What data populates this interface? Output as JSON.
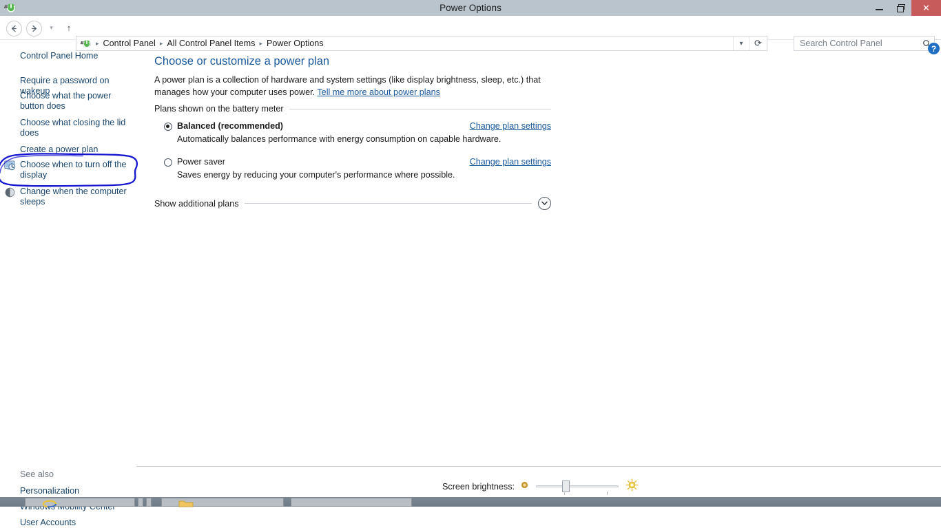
{
  "window": {
    "title": "Power Options",
    "icon": "power-options-icon",
    "controls": {
      "minimize": "–",
      "restore": "restore",
      "close": "✕"
    }
  },
  "navbar": {
    "back_icon": "←",
    "forward_icon": "→",
    "history_icon": "▾",
    "up_icon": "↑",
    "breadcrumbs": [
      "Control Panel",
      "All Control Panel Items",
      "Power Options"
    ],
    "separator": "▸",
    "dropdown_icon": "▾",
    "refresh_icon": "⟳"
  },
  "search": {
    "placeholder": "Search Control Panel",
    "value": "",
    "icon": "search-icon"
  },
  "help": {
    "label": "?"
  },
  "sidebar": {
    "home_label": "Control Panel Home",
    "items": [
      {
        "label": "Require a password on wakeup",
        "icon": null
      },
      {
        "label": "Choose what the power button does",
        "icon": null
      },
      {
        "label": "Choose what closing the lid does",
        "icon": null
      },
      {
        "label": "Create a power plan",
        "icon": null
      },
      {
        "label": "Choose when to turn off the display",
        "icon": "display-clock-icon"
      },
      {
        "label": "Change when the computer sleeps",
        "icon": "moon-sleep-icon"
      }
    ],
    "see_also_label": "See also",
    "see_also_items": [
      "Personalization",
      "Windows Mobility Center",
      "User Accounts"
    ]
  },
  "main": {
    "title": "Choose or customize a power plan",
    "description_part1": "A power plan is a collection of hardware and system settings (like display brightness, sleep, etc.) that manages how your computer uses power. ",
    "description_link": "Tell me more about power plans",
    "group_label": "Plans shown on the battery meter",
    "plans": [
      {
        "name": "Balanced (recommended)",
        "selected": true,
        "description": "Automatically balances performance with energy consumption on capable hardware.",
        "link": "Change plan settings"
      },
      {
        "name": "Power saver",
        "selected": false,
        "description": "Saves energy by reducing your computer's performance where possible.",
        "link": "Change plan settings"
      }
    ],
    "additional_label": "Show additional plans",
    "additional_chevron": "∨"
  },
  "brightness": {
    "label": "Screen brightness:",
    "low_icon": "dim-sun-icon",
    "high_icon": "bright-sun-icon",
    "value": 35
  },
  "annotation": {
    "type": "hand-drawn-ellipse",
    "color": "#1515d0",
    "target": "Choose when to turn off the display"
  },
  "colors": {
    "titlebar": "#bac4cc",
    "close_button": "#c75b5b",
    "link": "#18599e",
    "heading": "#18599e",
    "annotation": "#1515d0"
  }
}
